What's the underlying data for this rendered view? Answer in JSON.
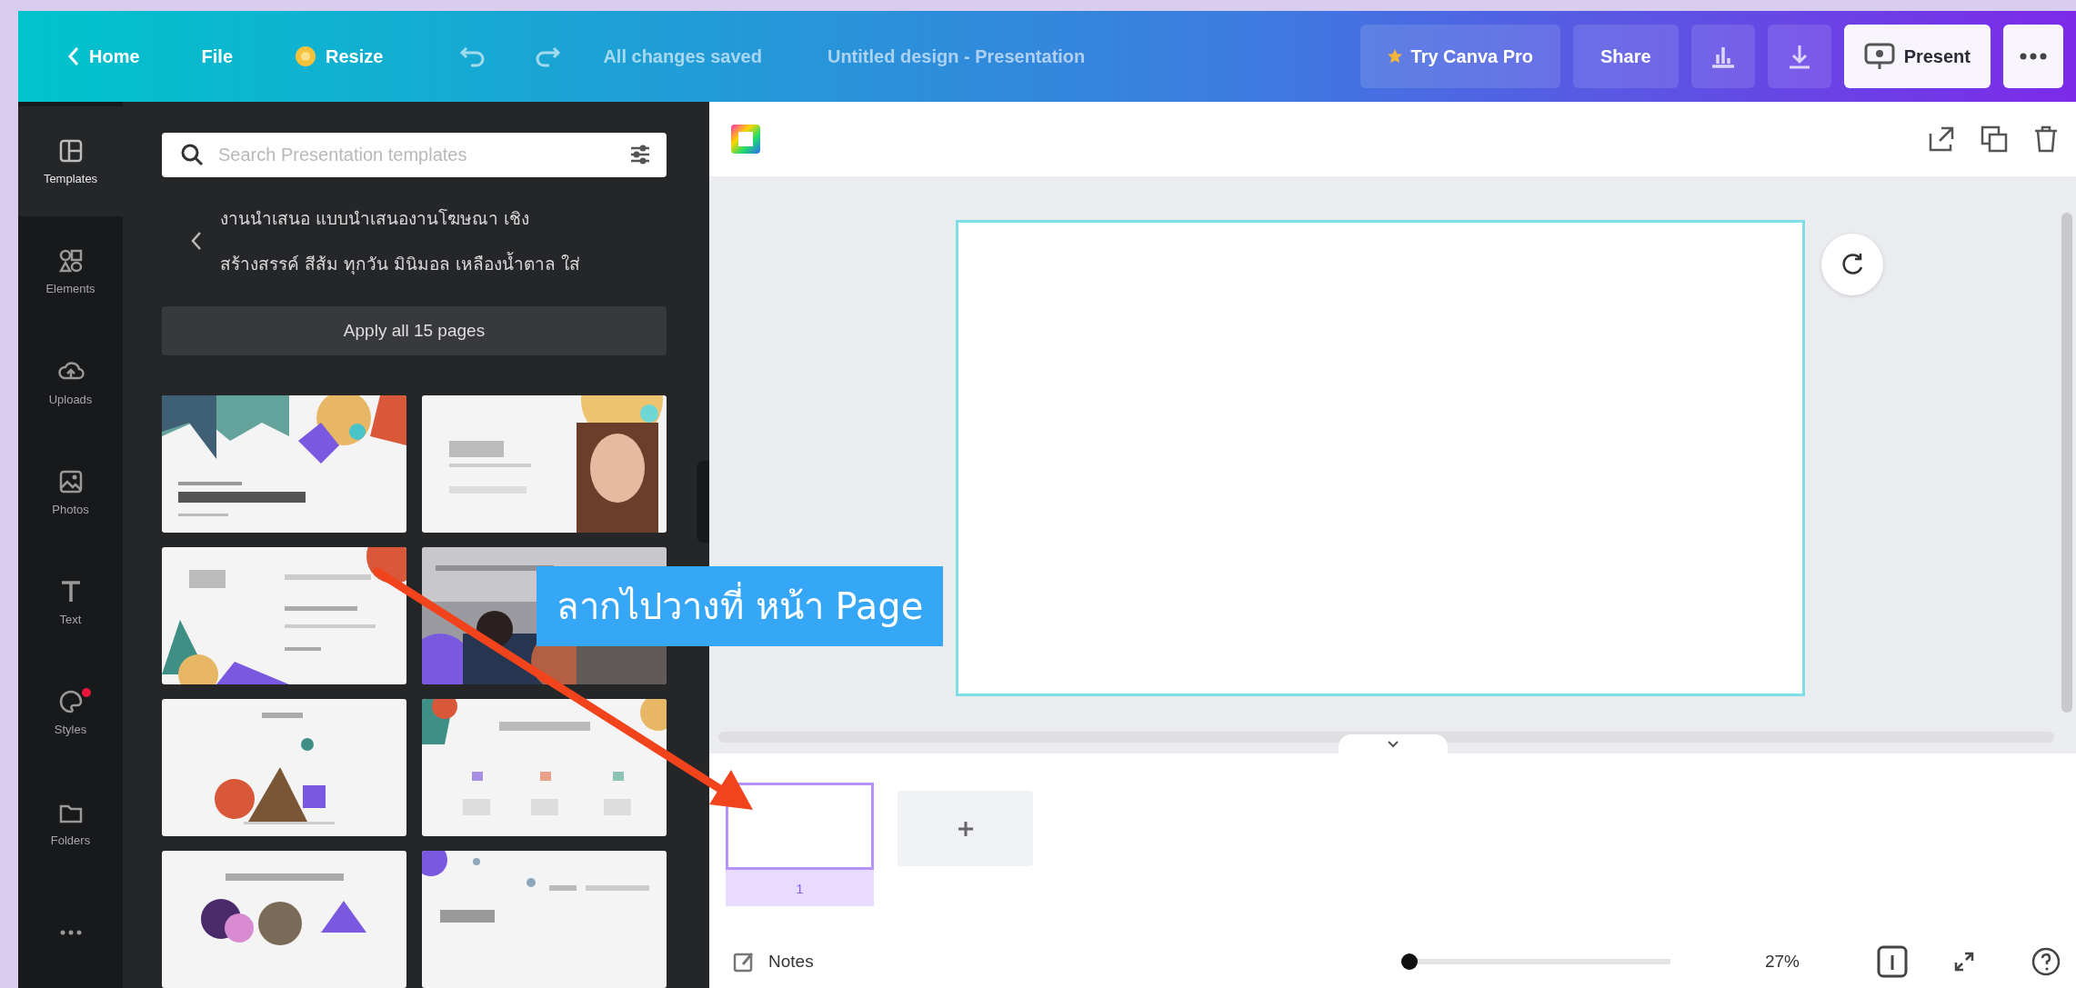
{
  "top_bar": {
    "home": "Home",
    "file": "File",
    "resize": "Resize",
    "save_status": "All changes saved",
    "document_title": "Untitled design - Presentation",
    "upgrade": "Try Canva Pro",
    "share": "Share",
    "present": "Present"
  },
  "side_rail": {
    "items": [
      {
        "kind": "templates",
        "label": "Templates",
        "selected": true,
        "notification": false
      },
      {
        "kind": "elements",
        "label": "Elements",
        "selected": false,
        "notification": false
      },
      {
        "kind": "uploads",
        "label": "Uploads",
        "selected": false,
        "notification": false
      },
      {
        "kind": "photos",
        "label": "Photos",
        "selected": false,
        "notification": false
      },
      {
        "kind": "text",
        "label": "Text",
        "selected": false,
        "notification": false
      },
      {
        "kind": "styles",
        "label": "Styles",
        "selected": false,
        "notification": true
      },
      {
        "kind": "folders",
        "label": "Folders",
        "selected": false,
        "notification": false
      },
      {
        "kind": "more",
        "selected": false,
        "notification": false
      }
    ]
  },
  "template_panel": {
    "search": {
      "placeholder": "Search Presentation templates"
    },
    "heading": "งานนำเสนอ แบบนำเสนองานโฆษณา เชิงสร้างสรรค์ สีส้ม ทุกวัน มินิมอล เหลืองน้ำตาล ใส่",
    "apply_button": "Apply all 15 pages"
  },
  "editor": {
    "pages": [
      {
        "number": "1",
        "selected": true
      }
    ],
    "footer": {
      "notes": "Notes",
      "zoom": {
        "level": 0.03,
        "reading": "27%"
      }
    }
  },
  "annotation": {
    "text": "ลากไปวางที่ หน้า Page"
  }
}
